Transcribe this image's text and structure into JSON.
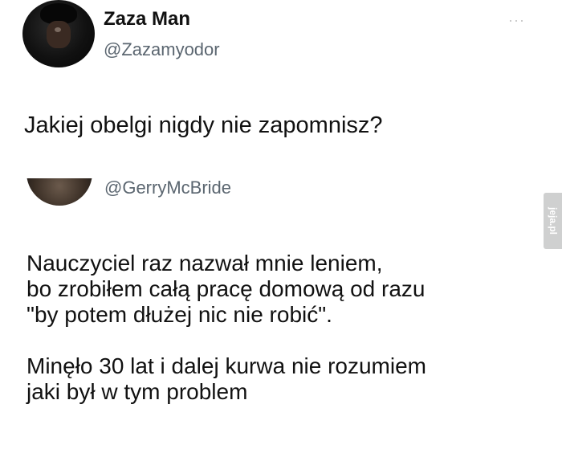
{
  "tweet": {
    "author_name": "Zaza Man",
    "author_handle": "@Zazamyodor",
    "more_icon": "···",
    "text": "Jakiej obelgi nigdy nie zapomnisz?"
  },
  "quote": {
    "handle": "@GerryMcBride",
    "paragraph1": [
      "Nauczyciel raz nazwał mnie leniem,",
      "bo zrobiłem całą pracę domową od razu",
      "\"by potem dłużej nic nie robić\"."
    ],
    "paragraph2": [
      "Minęło 30 lat i dalej kurwa nie rozumiem",
      "jaki był w tym problem"
    ]
  },
  "watermark": {
    "text": "jeja.pl"
  }
}
